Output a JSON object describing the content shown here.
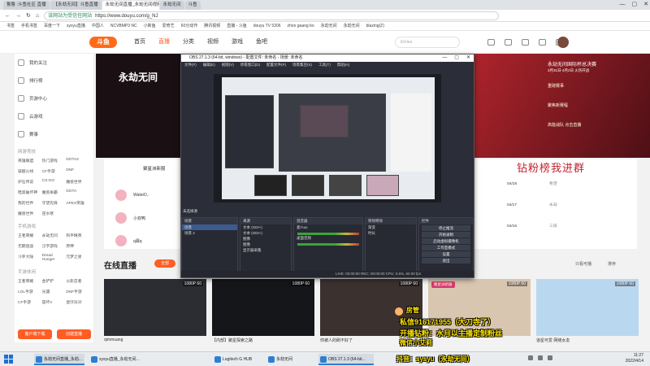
{
  "browser": {
    "tabs": [
      "鲁鲁 :斗鱼社区 直播",
      "【永劫无间】斗鱼直播",
      "永劫无间直播_永劫无间视频直播 - 斗鱼直播",
      "永劫无间",
      "斗鱼"
    ],
    "url": "https://www.douyu.com/g_NJ",
    "url_safe": "该网站为受信任网站",
    "bookmarks": [
      "书签",
      "手机书签",
      "百度一下",
      "sysyu直播",
      "中国人",
      "NCVBMP3 NC",
      "小新鱼",
      "爱奇艺",
      "60分动作",
      "腾讯视频",
      "直播 - 斗鱼",
      "douyu TV 5306",
      "zhoo gaang bo",
      "永劫无间",
      "永劫无间",
      "blazing(Z)"
    ],
    "window_controls": [
      "—",
      "▢",
      "✕"
    ]
  },
  "douyu": {
    "logo": "斗鱼",
    "nav": [
      {
        "label": "首页"
      },
      {
        "label": "直播",
        "active": true
      },
      {
        "label": "分类"
      },
      {
        "label": "视频"
      },
      {
        "label": "游戏"
      },
      {
        "label": "鱼吧"
      }
    ],
    "search_placeholder": "Ehrlee"
  },
  "sidebar": {
    "items": [
      "我的关注",
      "排行榜",
      "页游中心",
      "云游戏",
      "赛事"
    ],
    "section_games": "网游竞技",
    "games": [
      "英雄联盟",
      "热门游戏",
      "DOTA2",
      "穿越火线",
      "CF手游",
      "DNF",
      "炉石传说",
      "CS:GO",
      "魔兽世界",
      "暗黑破坏神",
      "魔兽争霸",
      "DOTA",
      "我的世界",
      "守望先锋",
      "APEX英雄",
      "魔兽世界",
      "逆水寒"
    ],
    "section_mobile": "手机游戏",
    "mobile": [
      "王者荣耀",
      "永劫无间",
      "和平精英",
      "无期迷途",
      "汉字游戏",
      "原神",
      "斗罗大陆",
      "Dread Hunger",
      "元梦之星"
    ],
    "section_fun": "手游休闲",
    "fun": [
      "王者荣耀",
      "金铲铲",
      "火影忍者",
      "LOL手游",
      "光遇",
      "DNF手游",
      "CF手游",
      "崩坏3",
      "蛋仔派对"
    ],
    "buttons": [
      "客户端下载",
      "创建直播"
    ]
  },
  "banner": {
    "title": "永劫无间",
    "right_title": "永劫无间国际杯总决赛",
    "right_sub": "3月31日-4月2日 火热开战",
    "items": [
      "重磅赛事",
      "聚焦新赛程",
      "高能战队 点击直播"
    ]
  },
  "streamers": {
    "title": "聚星洲新服",
    "names": [
      "WaterD..",
      "小双鸭",
      "q霖q"
    ]
  },
  "rank": {
    "heading": "钻粉榜我进群",
    "rows": [
      {
        "date": "04/18",
        "name": "希望"
      },
      {
        "date": "04/17",
        "name": "永劫"
      },
      {
        "date": "04/16",
        "name": "三排"
      }
    ]
  },
  "live": {
    "title": "在线直播",
    "button": "全部",
    "options": [
      "只看可播",
      "排序"
    ],
    "cards": [
      {
        "quality": "1080P 60",
        "caption": "只为尖锋",
        "src": "qimmuang"
      },
      {
        "quality": "1080P 60",
        "caption": "【内部】聚星探索之路",
        "src": "永劫无间"
      },
      {
        "quality": "1080P 60",
        "caption": "你被人的刷不好了",
        "src": "永劫无间"
      },
      {
        "quality": "1080P 60",
        "caption": "聚星洲新服",
        "src": "永劫无间"
      },
      {
        "quality": "1080P 60",
        "caption": "道星可爱 网络女友",
        "src": "永劫无间"
      }
    ]
  },
  "obs": {
    "title": "OBS 27.1.3 (64-bit, windows) - 配置文件: 未命名 - 场景: 未命名",
    "menu": [
      "文件(F)",
      "编辑(E)",
      "视图(V)",
      "停靠窗口(D)",
      "配置文件(P)",
      "场景集合(S)",
      "工具(T)",
      "帮助(H)"
    ],
    "controls": [
      "—",
      "▢",
      "✕"
    ],
    "scene_label": "未选择源",
    "docks": {
      "scenes": {
        "title": "场景",
        "items": [
          "场景",
          "场景 2"
        ]
      },
      "sources": {
        "title": "来源",
        "items": [
          "文本 (GDI+)",
          "文本 (GDI+)",
          "图像",
          "图像",
          "显示器采集"
        ]
      },
      "mixer": {
        "title": "混音器",
        "items": [
          "麦/Aux",
          "桌面音频"
        ]
      },
      "transitions": {
        "title": "转场特效",
        "items": [
          "渐变",
          "时长"
        ]
      },
      "controls": {
        "title": "控件",
        "items": [
          "停止推流",
          "开始录制",
          "启动虚拟摄像机",
          "工作室模式",
          "设置",
          "退出"
        ]
      }
    },
    "status": "LIVE: 00:00:00   REC: 00:00:00   CPU: 0.6%, 60.00 fps"
  },
  "overlay": {
    "lines": [
      "房管",
      "私信916171955（大刀寺了）",
      "开播钻粉：水月以主播定制粉丝",
      "微信小艾莉",
      "抖音：sysyu（永劫无间）"
    ]
  },
  "taskbar": {
    "apps": [
      "永劫无间直播_永劫...",
      "sysyu直播_永劫无间...",
      "",
      "",
      "",
      "",
      "Logitech G HUB",
      "永劫无间",
      "OBS 27.1.3 (64-bit...",
      "永劫无间"
    ],
    "time": "11:27",
    "date": "2022/4/14"
  }
}
